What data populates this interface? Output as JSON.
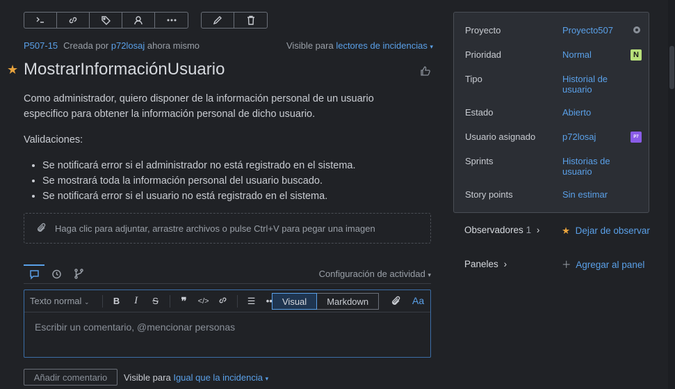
{
  "toolbar": {
    "left_icons": [
      "command-icon",
      "link-icon",
      "tag-icon",
      "user-icon",
      "more-icon"
    ],
    "right_icons": [
      "edit-icon",
      "trash-icon"
    ]
  },
  "meta": {
    "id": "P507-15",
    "created_by": "Creada por",
    "author": "p72losaj",
    "when": "ahora mismo",
    "visible_for": "Visible para",
    "visible_group": "lectores de incidencias"
  },
  "issue": {
    "title": "MostrarInformaciónUsuario",
    "paragraph": "Como administrador, quiero disponer de la información personal de un usuario especifico para obtener la información personal de dicho usuario.",
    "validations_label": "Validaciones:",
    "validations": [
      "Se notificará error si el administrador no está registrado en el sistema.",
      "Se mostrará toda la información personal del usuario buscado.",
      "Se notificará error si el usuario no está registrado en el sistema."
    ]
  },
  "attach": {
    "text": "Haga clic para adjuntar, arrastre archivos o pulse Ctrl+V para pegar una imagen"
  },
  "activity": {
    "config_label": "Configuración de actividad"
  },
  "editor": {
    "format": "Texto normal",
    "visual": "Visual",
    "markdown": "Markdown",
    "aa": "Aa",
    "placeholder": "Escribir un comentario, @mencionar personas",
    "add_comment": "Añadir comentario",
    "visible_for": "Visible para",
    "visible_value": "Igual que la incidencia"
  },
  "panel": {
    "rows": [
      {
        "label": "Proyecto",
        "value": "Proyecto507"
      },
      {
        "label": "Prioridad",
        "value": "Normal",
        "badge": "N"
      },
      {
        "label": "Tipo",
        "value": "Historial de usuario"
      },
      {
        "label": "Estado",
        "value": "Abierto"
      },
      {
        "label": "Usuario asignado",
        "value": "p72losaj",
        "avatar": "P7"
      },
      {
        "label": "Sprints",
        "value": "Historias de usuario"
      },
      {
        "label": "Story points",
        "value": "Sin estimar"
      }
    ]
  },
  "side": {
    "watchers_label": "Observadores",
    "watchers_count": "1",
    "watch_action": "Dejar de observar",
    "boards_label": "Paneles",
    "boards_action": "Agregar al panel"
  },
  "colors": {
    "accent": "#5aa0e8",
    "background": "#202226",
    "panel": "#2b2e34",
    "star": "#e8a33d",
    "priority_badge": "#b8e07a",
    "avatar": "#8a5ce8"
  }
}
